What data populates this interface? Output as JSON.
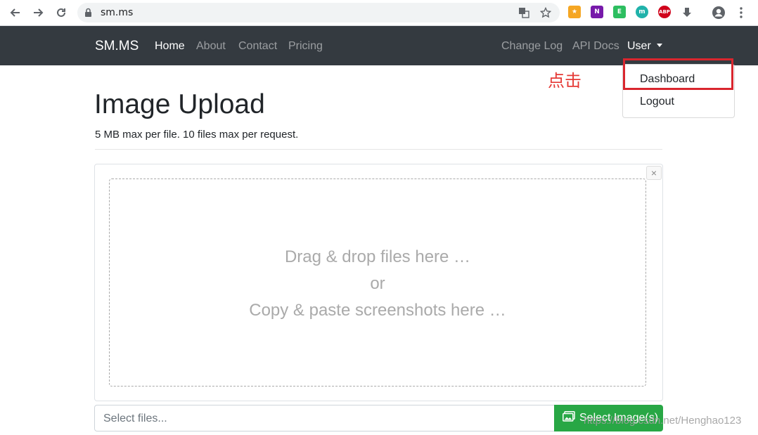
{
  "browser": {
    "url": "sm.ms",
    "extensions": [
      {
        "name": "bookmark-extension-icon",
        "label": "★",
        "color": "#f5a623"
      },
      {
        "name": "onenote-extension-icon",
        "label": "N",
        "color": "#7719aa"
      },
      {
        "name": "evernote-extension-icon",
        "label": "E",
        "color": "#2dbe60"
      },
      {
        "name": "m-extension-icon",
        "label": "m",
        "color": "#20b2aa"
      },
      {
        "name": "adblock-plus-icon",
        "label": "ABP",
        "color": "#d0021b"
      }
    ]
  },
  "navbar": {
    "brand": "SM.MS",
    "links": [
      "Home",
      "About",
      "Contact",
      "Pricing"
    ],
    "right_links": [
      "Change Log",
      "API Docs"
    ],
    "user_menu": "User",
    "bg_color": "#343a40"
  },
  "dropdown": {
    "items": [
      "Dashboard",
      "Logout"
    ]
  },
  "annotation": {
    "text": "点击",
    "color": "#e53935"
  },
  "main": {
    "title": "Image Upload",
    "subtitle": "5 MB max per file. 10 files max per request.",
    "drop_line1": "Drag & drop files here …",
    "drop_line2": "or",
    "drop_line3": "Copy & paste screenshots here …",
    "file_placeholder": "Select files...",
    "select_button": "Select Image(s)",
    "button_color": "#28a745"
  },
  "watermark": "https://blog.csdn.net/Henghao123"
}
